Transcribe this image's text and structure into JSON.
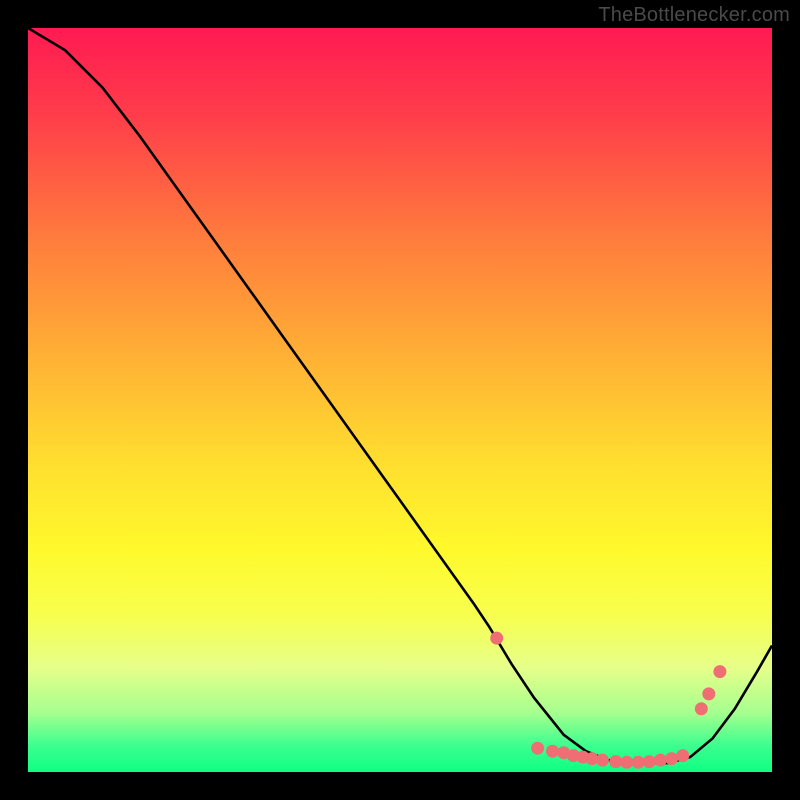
{
  "watermark": "TheBottlenecker.com",
  "chart_data": {
    "type": "line",
    "title": "",
    "xlabel": "",
    "ylabel": "",
    "xlim": [
      0,
      100
    ],
    "ylim": [
      0,
      100
    ],
    "grid": false,
    "legend": false,
    "gradient_stops": [
      {
        "pos": 0.0,
        "color": "#ff1a52"
      },
      {
        "pos": 0.12,
        "color": "#ff3e4a"
      },
      {
        "pos": 0.28,
        "color": "#ff7b3d"
      },
      {
        "pos": 0.44,
        "color": "#ffb035"
      },
      {
        "pos": 0.58,
        "color": "#ffdd2f"
      },
      {
        "pos": 0.7,
        "color": "#fff92c"
      },
      {
        "pos": 0.79,
        "color": "#f7ff4e"
      },
      {
        "pos": 0.86,
        "color": "#e6ff8a"
      },
      {
        "pos": 0.92,
        "color": "#a6ff8e"
      },
      {
        "pos": 0.965,
        "color": "#3bff8f"
      },
      {
        "pos": 1.0,
        "color": "#0fff83"
      }
    ],
    "series": [
      {
        "name": "bottleneck-curve",
        "color": "#000000",
        "x": [
          0,
          5,
          10,
          15,
          20,
          25,
          30,
          35,
          40,
          45,
          50,
          55,
          60,
          62,
          65,
          68,
          72,
          75,
          78,
          82,
          86,
          89,
          92,
          95,
          98,
          100
        ],
        "y": [
          100,
          97,
          92,
          85.5,
          78.5,
          71.5,
          64.5,
          57.5,
          50.5,
          43.5,
          36.5,
          29.5,
          22.5,
          19.5,
          14.5,
          10,
          5.0,
          2.8,
          1.6,
          1.2,
          1.2,
          2.0,
          4.5,
          8.5,
          13.5,
          17
        ]
      }
    ],
    "markers": {
      "color": "#ef6e74",
      "radius": 6.5,
      "points": [
        {
          "x": 63,
          "y": 18
        },
        {
          "x": 68.5,
          "y": 3.2
        },
        {
          "x": 70.5,
          "y": 2.8
        },
        {
          "x": 72,
          "y": 2.6
        },
        {
          "x": 73.3,
          "y": 2.2
        },
        {
          "x": 74.6,
          "y": 2.0
        },
        {
          "x": 75.8,
          "y": 1.8
        },
        {
          "x": 77.2,
          "y": 1.6
        },
        {
          "x": 79.0,
          "y": 1.4
        },
        {
          "x": 80.5,
          "y": 1.3
        },
        {
          "x": 82.0,
          "y": 1.3
        },
        {
          "x": 83.5,
          "y": 1.4
        },
        {
          "x": 85.0,
          "y": 1.6
        },
        {
          "x": 86.5,
          "y": 1.8
        },
        {
          "x": 88.0,
          "y": 2.2
        },
        {
          "x": 90.5,
          "y": 8.5
        },
        {
          "x": 91.5,
          "y": 10.5
        },
        {
          "x": 93.0,
          "y": 13.5
        }
      ]
    }
  }
}
